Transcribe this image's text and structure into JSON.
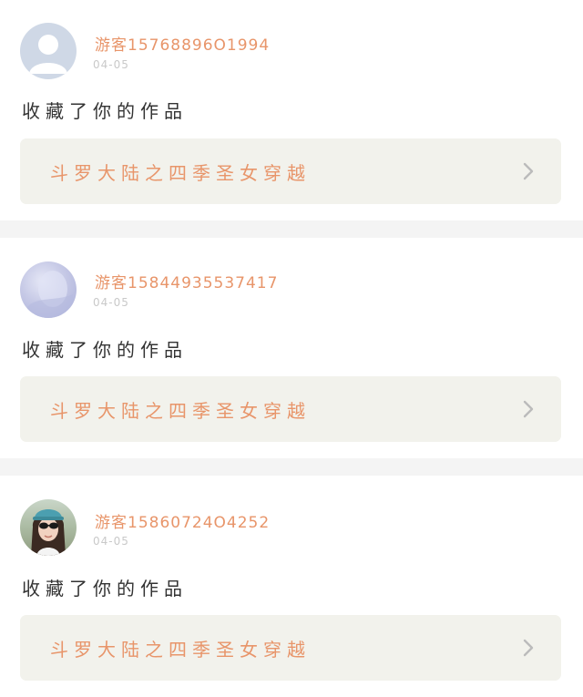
{
  "feed": [
    {
      "username": "游客15768896O1994",
      "date": "04-05",
      "action": "收藏了你的作品",
      "work_title": "斗罗大陆之四季圣女穿越",
      "avatar_style": "default"
    },
    {
      "username": "游客15844935537417",
      "date": "04-05",
      "action": "收藏了你的作品",
      "work_title": "斗罗大陆之四季圣女穿越",
      "avatar_style": "lavender"
    },
    {
      "username": "游客15860724O4252",
      "date": "04-05",
      "action": "收藏了你的作品",
      "work_title": "斗罗大陆之四季圣女穿越",
      "avatar_style": "photo"
    }
  ],
  "icons": {
    "default_avatar": "user-silhouette-icon",
    "chevron": "chevron-right-icon"
  },
  "colors": {
    "accent": "#e8956a",
    "date": "#c9c9c9",
    "work_bg": "#f2f2ec",
    "page_bg": "#f4f4f4"
  }
}
